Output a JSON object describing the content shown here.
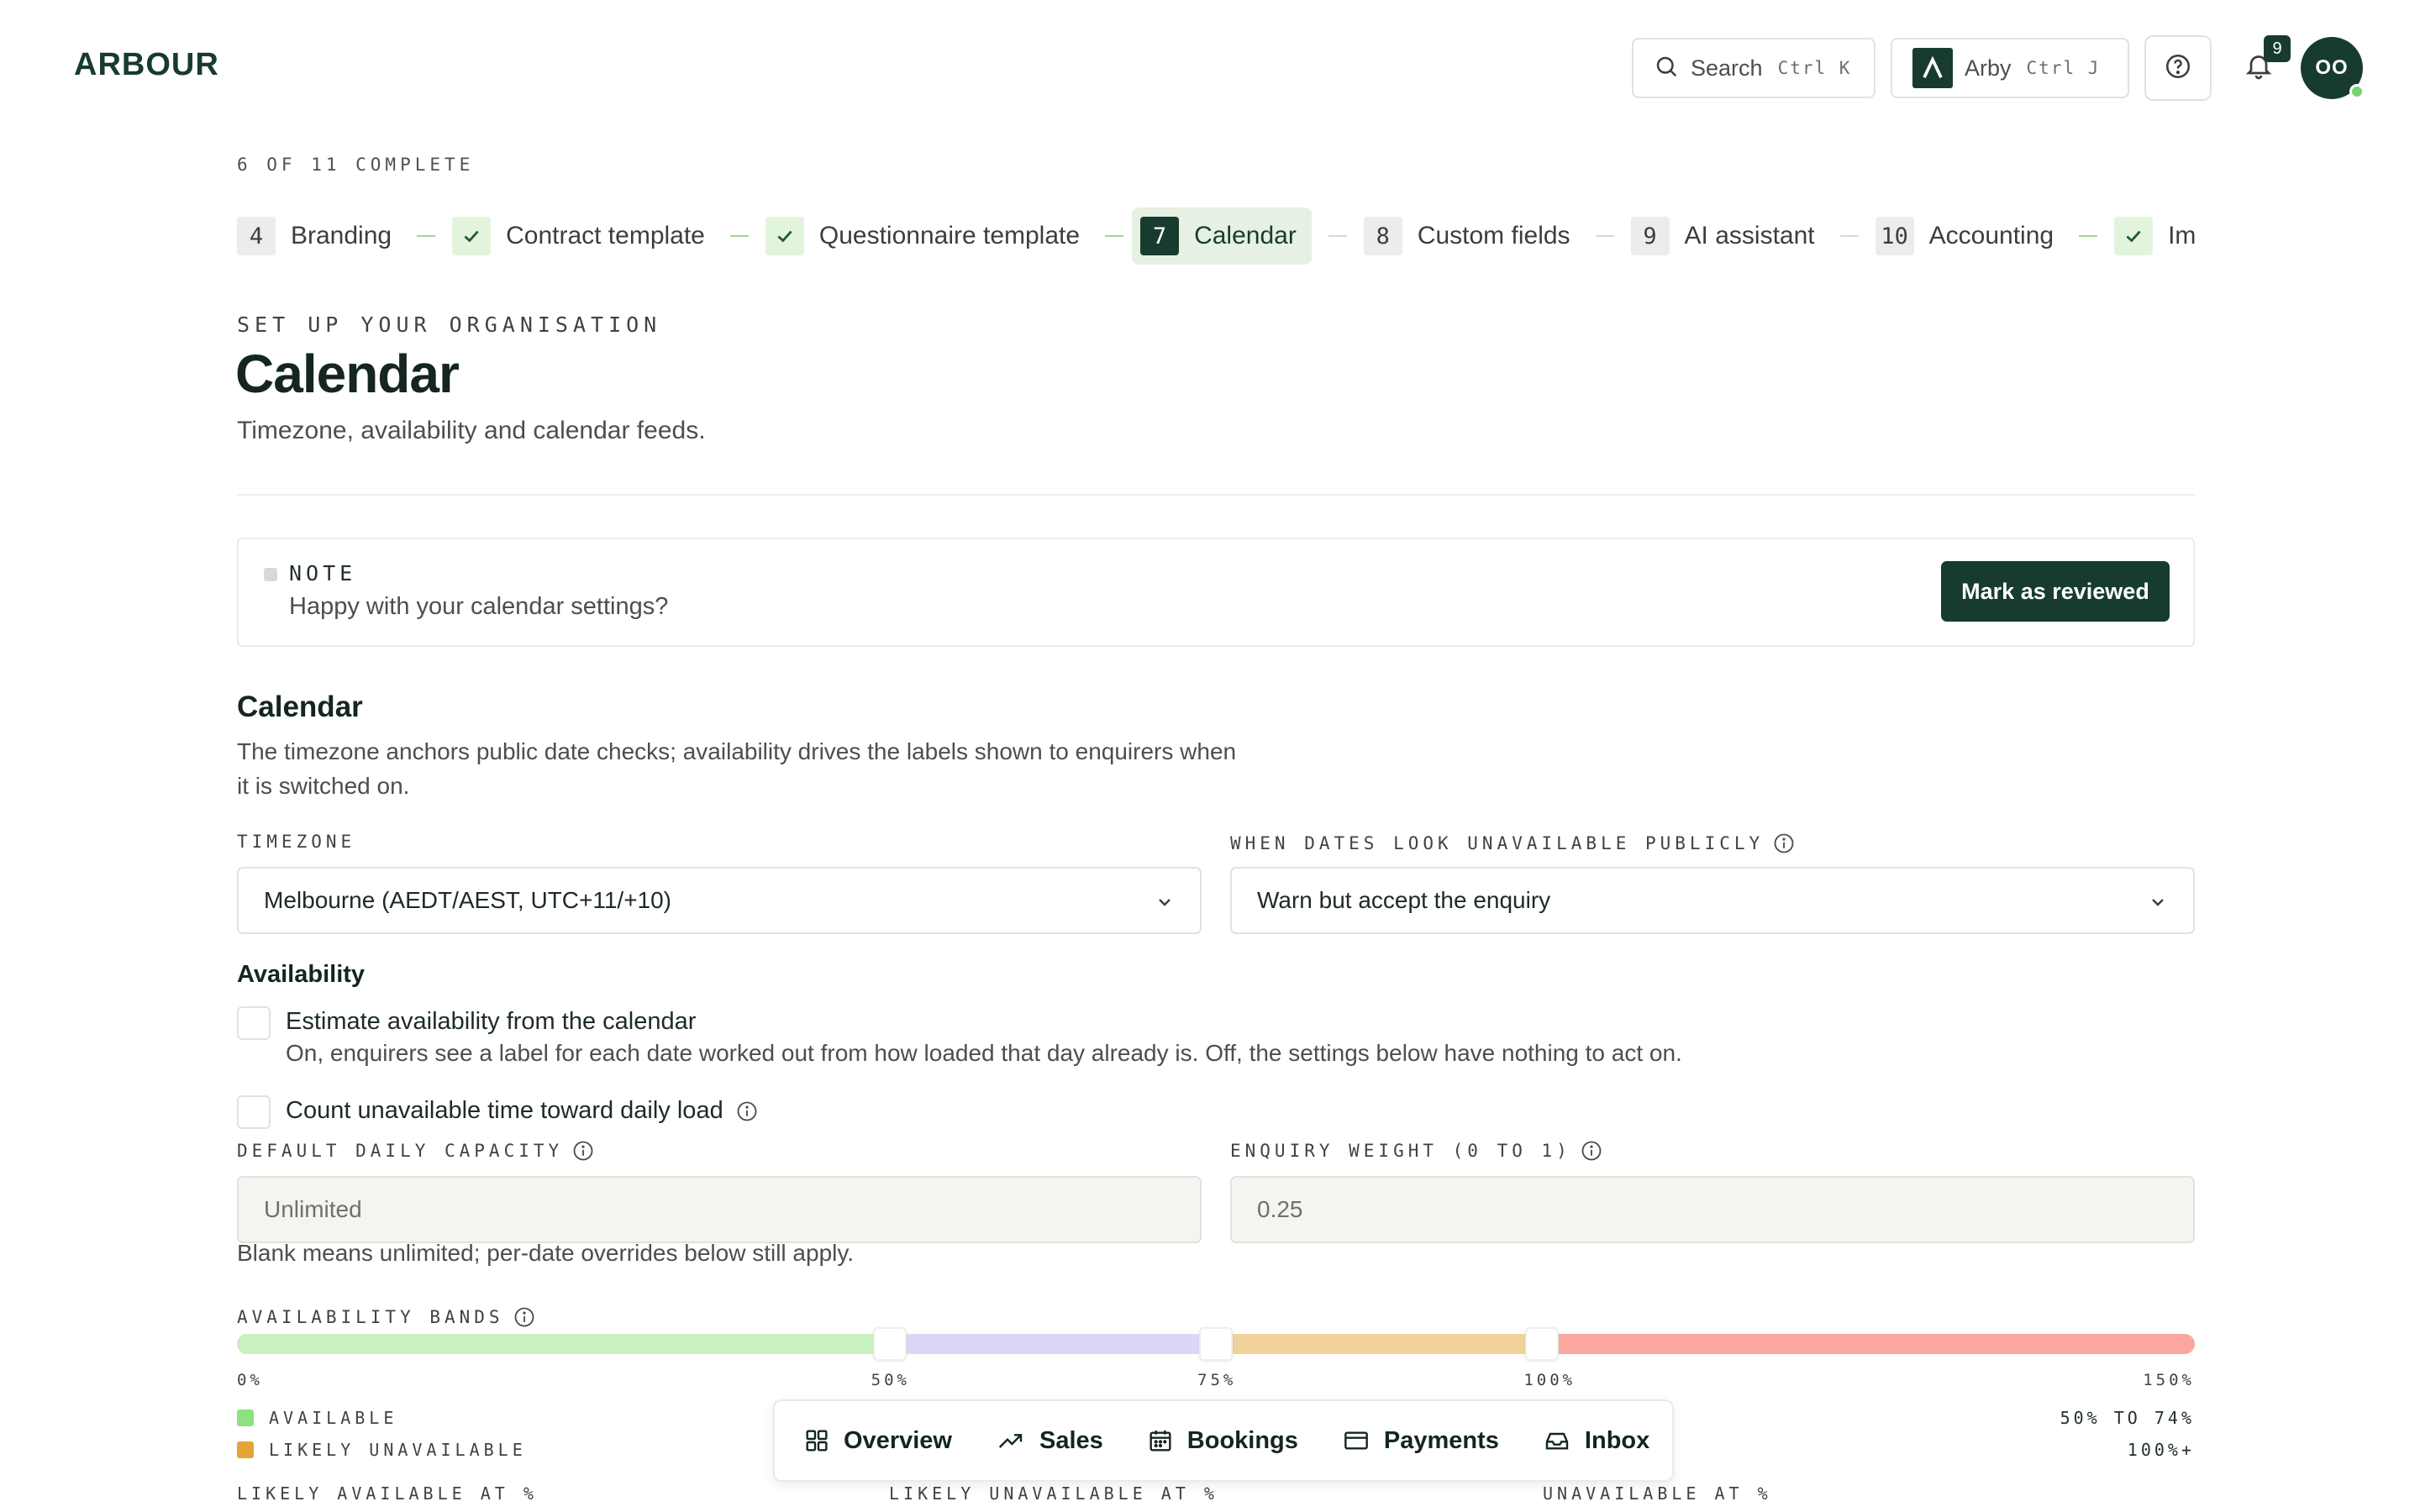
{
  "header": {
    "logo": "ARBOUR",
    "search_label": "Search",
    "search_shortcut": "Ctrl K",
    "assistant_label": "Arby",
    "assistant_shortcut": "Ctrl J",
    "notification_count": "9",
    "avatar_initials": "OO"
  },
  "progress": {
    "label": "6 OF 11 COMPLETE",
    "steps": [
      {
        "num": "4",
        "name": "Branding",
        "state": "todo"
      },
      {
        "num": "",
        "name": "Contract template",
        "state": "done"
      },
      {
        "num": "",
        "name": "Questionnaire template",
        "state": "done"
      },
      {
        "num": "7",
        "name": "Calendar",
        "state": "active"
      },
      {
        "num": "8",
        "name": "Custom fields",
        "state": "todo"
      },
      {
        "num": "9",
        "name": "AI assistant",
        "state": "todo"
      },
      {
        "num": "10",
        "name": "Accounting",
        "state": "todo"
      },
      {
        "num": "",
        "name": "Imports",
        "state": "done"
      }
    ]
  },
  "page": {
    "eyebrow": "SET UP YOUR ORGANISATION",
    "title": "Calendar",
    "subtitle": "Timezone, availability and calendar feeds."
  },
  "note": {
    "title": "NOTE",
    "text": "Happy with your calendar settings?",
    "button": "Mark as reviewed"
  },
  "calendar": {
    "title": "Calendar",
    "description": "The timezone anchors public date checks; availability drives the labels shown to enquirers when it is switched on.",
    "timezone_label": "TIMEZONE",
    "timezone_value": "Melbourne (AEDT/AEST, UTC+11/+10)",
    "unavailable_label": "WHEN DATES LOOK UNAVAILABLE PUBLICLY",
    "unavailable_value": "Warn but accept the enquiry"
  },
  "availability": {
    "title": "Availability",
    "estimate_label": "Estimate availability from the calendar",
    "estimate_checked": false,
    "estimate_help": "On, enquirers see a label for each date worked out from how loaded that day already is. Off, the settings below have nothing to act on.",
    "count_label": "Count unavailable time toward daily load",
    "count_checked": false,
    "capacity_label": "DEFAULT DAILY CAPACITY",
    "capacity_placeholder": "Unlimited",
    "weight_label": "ENQUIRY WEIGHT (0 TO 1)",
    "weight_value": "0.25",
    "helper": "Blank means unlimited; per-date overrides below still apply."
  },
  "bands": {
    "label": "AVAILABILITY BANDS",
    "max_percent": 150,
    "thresholds": [
      50,
      75,
      100
    ],
    "ticks": [
      "0%",
      "50%",
      "75%",
      "100%",
      "150%"
    ],
    "colors": [
      "#caf0be",
      "#ddd6f7",
      "#f1d29b",
      "#fca6a1"
    ],
    "legend": [
      {
        "label": "AVAILABLE",
        "color": "#8ee27e"
      },
      {
        "label": "LIKELY UNAVAILABLE",
        "color": "#e6a532"
      }
    ],
    "right_values": [
      "50% TO 74%",
      "100%+"
    ],
    "columns": [
      "LIKELY AVAILABLE AT %",
      "LIKELY UNAVAILABLE AT %",
      "UNAVAILABLE AT %"
    ]
  },
  "bottom_nav": [
    {
      "label": "Overview",
      "icon": "grid-icon"
    },
    {
      "label": "Sales",
      "icon": "trend-up-icon"
    },
    {
      "label": "Bookings",
      "icon": "calendar-icon"
    },
    {
      "label": "Payments",
      "icon": "card-icon"
    },
    {
      "label": "Inbox",
      "icon": "inbox-icon"
    }
  ]
}
